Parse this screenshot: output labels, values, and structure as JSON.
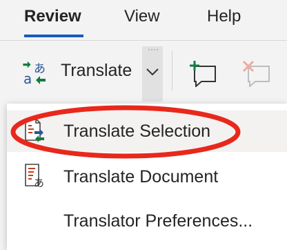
{
  "tabs": [
    {
      "label": "Review",
      "active": true
    },
    {
      "label": "View",
      "active": false
    },
    {
      "label": "Help",
      "active": false
    }
  ],
  "ribbon": {
    "translate_label": "Translate",
    "translate_icon": "translate-icon",
    "new_comment_icon": "new-comment-icon",
    "delete_comment_icon": "delete-comment-icon"
  },
  "menu": {
    "items": [
      {
        "label": "Translate Selection",
        "icon": "translate-selection-icon",
        "highlighted": true
      },
      {
        "label": "Translate Document",
        "icon": "translate-document-icon",
        "highlighted": false
      },
      {
        "label": "Translator Preferences...",
        "icon": "",
        "highlighted": false
      }
    ]
  },
  "colors": {
    "accent": "#185abd",
    "annotation": "#e8281c",
    "green": "#107c41",
    "icon_blue": "#2b579a",
    "icon_red": "#c43e1c"
  }
}
